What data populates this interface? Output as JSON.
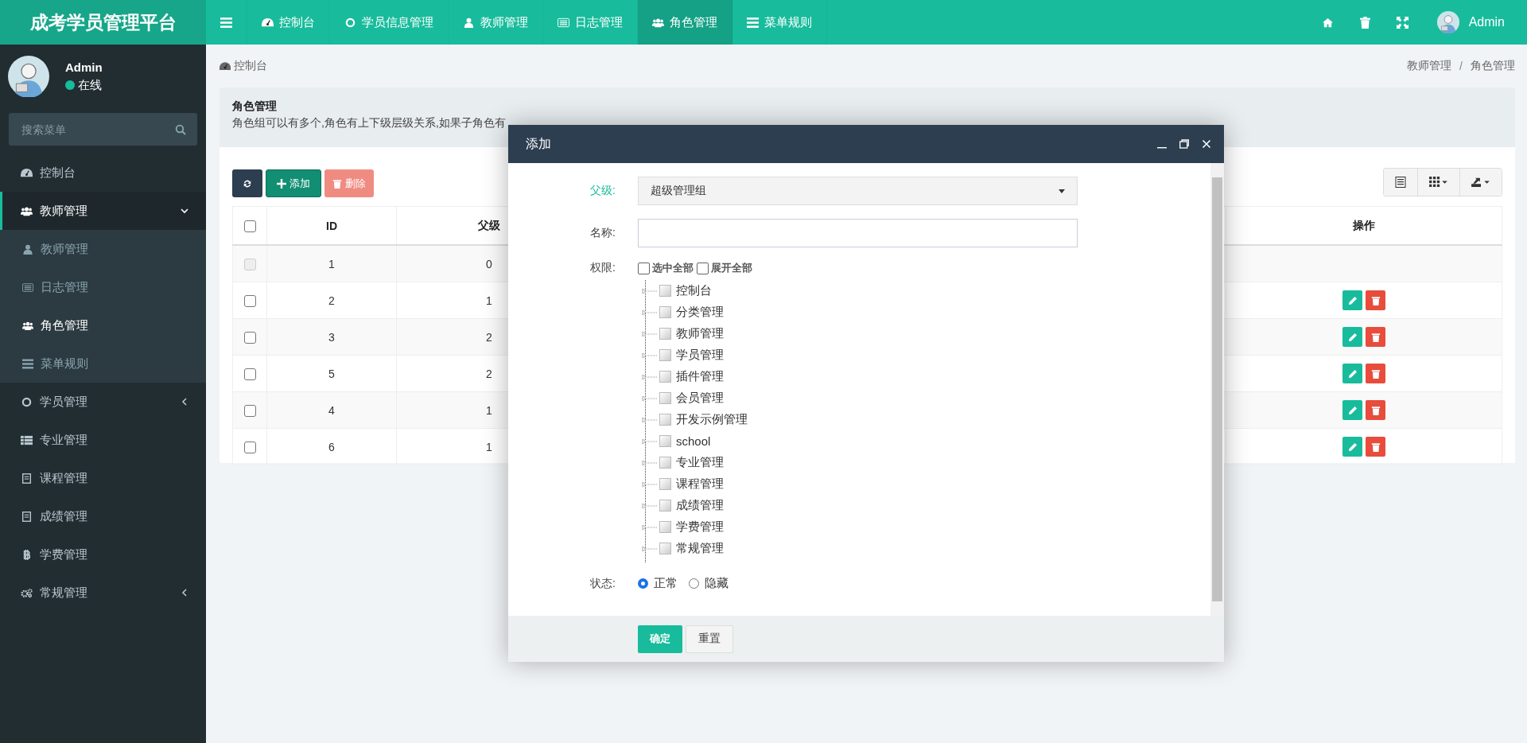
{
  "brand": "成考学员管理平台",
  "top_nav": [
    {
      "label": "控制台",
      "selected": false
    },
    {
      "label": "学员信息管理",
      "selected": false
    },
    {
      "label": "教师管理",
      "selected": false
    },
    {
      "label": "日志管理",
      "selected": false
    },
    {
      "label": "角色管理",
      "selected": true
    },
    {
      "label": "菜单规则",
      "selected": false
    }
  ],
  "top_user": "Admin",
  "sidebar": {
    "user": {
      "name": "Admin",
      "status": "在线",
      "color": "#18bc9c"
    },
    "search": {
      "placeholder": "搜索菜单"
    },
    "items": [
      {
        "label": "控制台",
        "selected": false
      },
      {
        "label": "教师管理",
        "selected": true,
        "expanded": true,
        "children": [
          {
            "label": "教师管理",
            "selected": false
          },
          {
            "label": "日志管理",
            "selected": false
          },
          {
            "label": "角色管理",
            "selected": true
          },
          {
            "label": "菜单规则",
            "selected": false
          }
        ]
      },
      {
        "label": "学员管理",
        "selected": false,
        "expanded": false
      },
      {
        "label": "专业管理",
        "selected": false
      },
      {
        "label": "课程管理",
        "selected": false
      },
      {
        "label": "成绩管理",
        "selected": false
      },
      {
        "label": "学费管理",
        "selected": false
      },
      {
        "label": "常规管理",
        "selected": false,
        "expanded": false
      }
    ]
  },
  "breadcrumb": {
    "home": "控制台",
    "separator": "/",
    "path": [
      "教师管理",
      "角色管理"
    ]
  },
  "panel": {
    "title": "角色管理",
    "description": "角色组可以有多个,角色有上下级层级关系,如果子角色有"
  },
  "toolbar": {
    "add": "添加",
    "delete": "删除"
  },
  "table": {
    "select_all": {
      "checked": false
    },
    "columns": [
      "ID",
      "父级",
      "操作"
    ],
    "rows": [
      {
        "id": "1",
        "parent": "0",
        "disabled": true,
        "actions": false
      },
      {
        "id": "2",
        "parent": "1",
        "disabled": false,
        "actions": true
      },
      {
        "id": "3",
        "parent": "2",
        "disabled": false,
        "actions": true
      },
      {
        "id": "5",
        "parent": "2",
        "disabled": false,
        "actions": true
      },
      {
        "id": "4",
        "parent": "1",
        "disabled": false,
        "actions": true
      },
      {
        "id": "6",
        "parent": "1",
        "disabled": false,
        "actions": true
      }
    ]
  },
  "dialog": {
    "title": "添加",
    "parent_label": "父级:",
    "parent_value": "超级管理组",
    "name_label": "名称:",
    "rules_label": "权限:",
    "select_all": {
      "label": "选中全部",
      "checked": false
    },
    "expand_all": {
      "label": "展开全部",
      "checked": false
    },
    "tree": [
      {
        "label": "控制台",
        "checked": false
      },
      {
        "label": "分类管理",
        "checked": false
      },
      {
        "label": "教师管理",
        "checked": false
      },
      {
        "label": "学员管理",
        "checked": false
      },
      {
        "label": "插件管理",
        "checked": false
      },
      {
        "label": "会员管理",
        "checked": false
      },
      {
        "label": "开发示例管理",
        "checked": false
      },
      {
        "label": "school",
        "checked": false
      },
      {
        "label": "专业管理",
        "checked": false
      },
      {
        "label": "课程管理",
        "checked": false
      },
      {
        "label": "成绩管理",
        "checked": false
      },
      {
        "label": "学费管理",
        "checked": false
      },
      {
        "label": "常规管理",
        "checked": false
      }
    ],
    "status_label": "状态:",
    "status_options": [
      {
        "label": "正常",
        "selected": true
      },
      {
        "label": "隐藏",
        "selected": false
      }
    ],
    "submit": "确定",
    "reset": "重置"
  }
}
